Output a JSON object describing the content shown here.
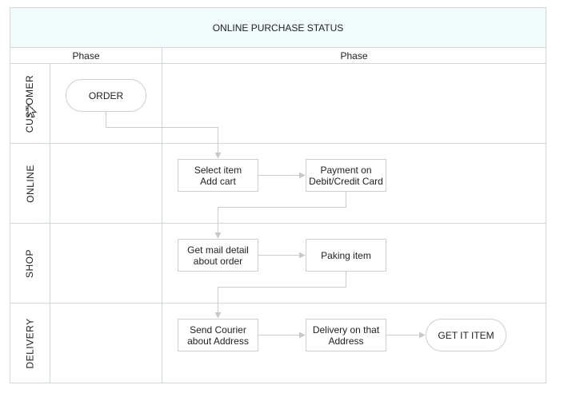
{
  "title": "ONLINE PURCHASE STATUS",
  "phases": [
    "Phase",
    "Phase"
  ],
  "lanes": [
    "CUSTOMER",
    "ONLINE",
    "SHOP",
    "DELIVERY"
  ],
  "nodes": {
    "order": "ORDER",
    "select_item": "Select item\nAdd cart",
    "payment": "Payment on\nDebit/Credit Card",
    "mail_detail": "Get mail detail\nabout order",
    "paking": "Paking item",
    "send_courier": "Send Courier\nabout Address",
    "delivery_address": "Delivery on that\nAddress",
    "get_it": "GET IT ITEM"
  },
  "colors": {
    "header_bg": "#f2fbfb",
    "line": "#d0d8d8",
    "connector": "#cccccc"
  }
}
